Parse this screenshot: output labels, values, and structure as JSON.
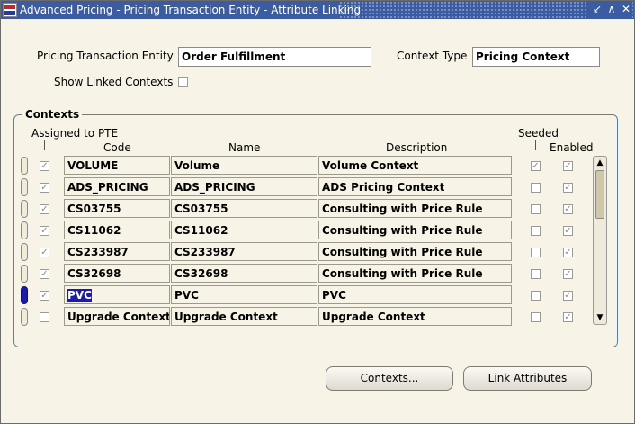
{
  "window": {
    "title": "Advanced Pricing - Pricing Transaction Entity - Attribute Linking",
    "controls": [
      "↙",
      "⊼",
      "✕"
    ]
  },
  "form": {
    "pte_label": "Pricing Transaction Entity",
    "pte_value": "Order Fulfillment",
    "context_type_label": "Context Type",
    "context_type_value": "Pricing Context",
    "show_linked_label": "Show Linked Contexts"
  },
  "contexts": {
    "group_title": "Contexts",
    "headers": {
      "assigned": "Assigned to PTE",
      "code": "Code",
      "name": "Name",
      "description": "Description",
      "seeded": "Seeded",
      "enabled": "Enabled"
    },
    "rows": [
      {
        "code": "VOLUME",
        "name": "Volume",
        "description": "Volume Context",
        "assigned": true,
        "seeded": true,
        "enabled": true
      },
      {
        "code": "ADS_PRICING",
        "name": "ADS_PRICING",
        "description": "ADS Pricing Context",
        "assigned": true,
        "seeded": false,
        "enabled": true
      },
      {
        "code": "CS03755",
        "name": "CS03755",
        "description": "Consulting with Price Rule",
        "assigned": true,
        "seeded": false,
        "enabled": true
      },
      {
        "code": "CS11062",
        "name": "CS11062",
        "description": "Consulting with Price Rule",
        "assigned": true,
        "seeded": false,
        "enabled": true
      },
      {
        "code": "CS233987",
        "name": "CS233987",
        "description": "Consulting with Price Rule",
        "assigned": true,
        "seeded": false,
        "enabled": true
      },
      {
        "code": "CS32698",
        "name": "CS32698",
        "description": "Consulting with Price Rule",
        "assigned": true,
        "seeded": false,
        "enabled": true
      },
      {
        "code": "PVC",
        "name": "PVC",
        "description": "PVC",
        "assigned": true,
        "seeded": false,
        "enabled": true,
        "selected": true
      },
      {
        "code": "Upgrade Context",
        "name": "Upgrade Context",
        "description": "Upgrade Context",
        "assigned": false,
        "seeded": false,
        "enabled": true
      }
    ]
  },
  "buttons": {
    "contexts": "Contexts...",
    "link_attributes": "Link Attributes"
  },
  "colors": {
    "title_bar": "#3b5ca0",
    "selection": "#1c1ca8",
    "background": "#f7f3e6"
  }
}
